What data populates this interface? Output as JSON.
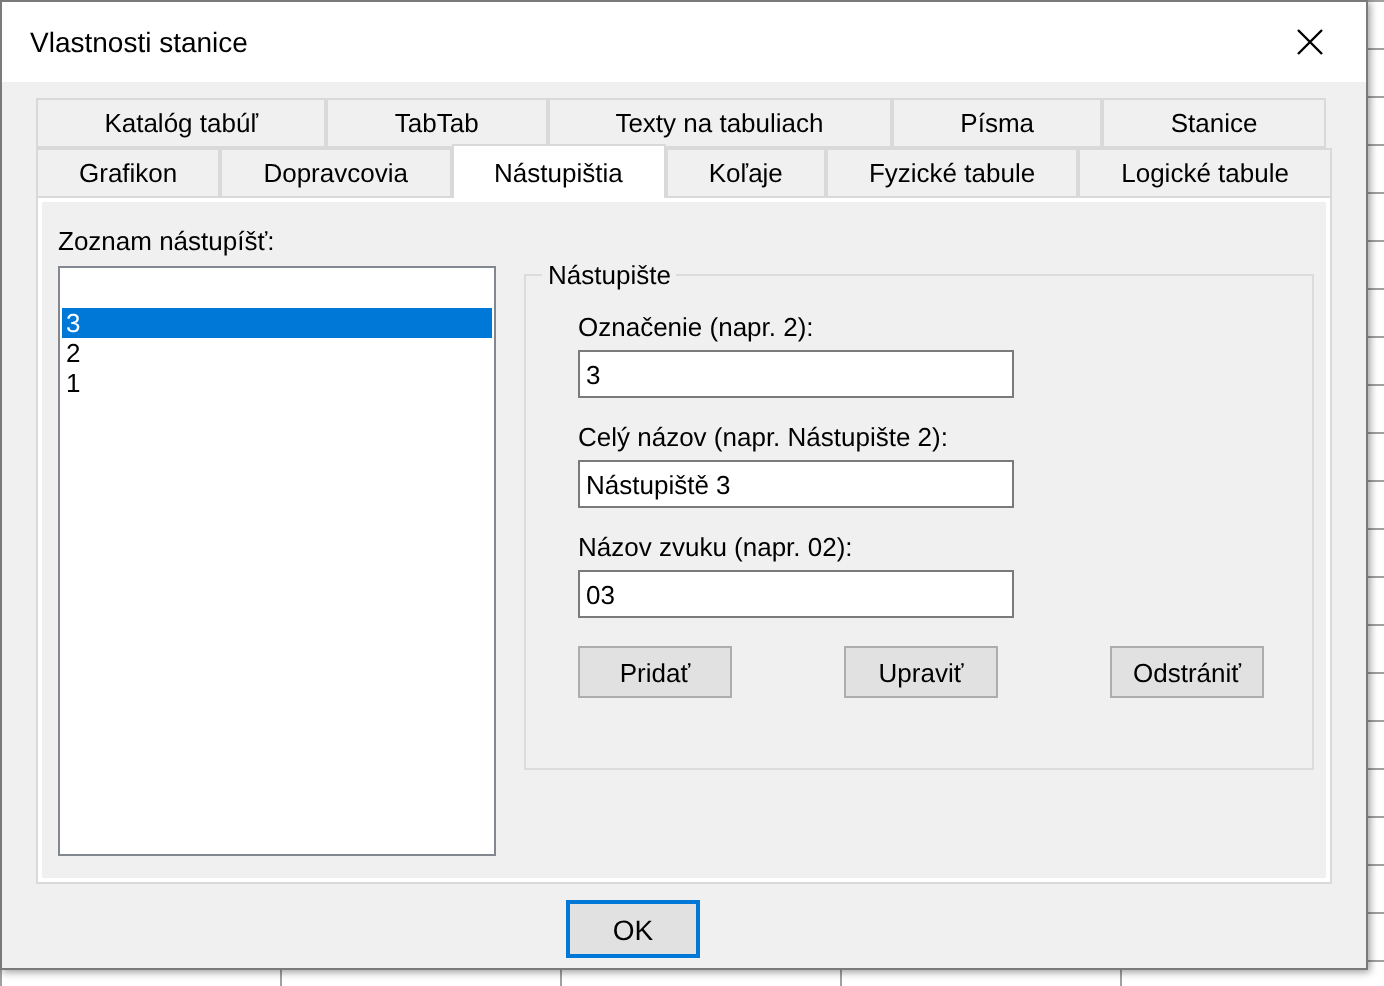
{
  "window": {
    "title": "Vlastnosti stanice"
  },
  "tab_rows": [
    [
      {
        "label": "Katalóg tabúľ",
        "selected": false
      },
      {
        "label": "TabTab",
        "selected": false
      },
      {
        "label": "Texty na tabuliach",
        "selected": false
      },
      {
        "label": "Písma",
        "selected": false
      },
      {
        "label": "Stanice",
        "selected": false
      }
    ],
    [
      {
        "label": "Grafikon",
        "selected": false
      },
      {
        "label": "Dopravcovia",
        "selected": false
      },
      {
        "label": "Nástupištia",
        "selected": true
      },
      {
        "label": "Koľaje",
        "selected": false
      },
      {
        "label": "Fyzické tabule",
        "selected": false
      },
      {
        "label": "Logické tabule",
        "selected": false
      }
    ]
  ],
  "platform_list": {
    "label": "Zoznam nástupíšť:",
    "items": [
      {
        "label": "3",
        "selected": true
      },
      {
        "label": "2",
        "selected": false
      },
      {
        "label": "1",
        "selected": false
      }
    ]
  },
  "group": {
    "title": "Nástupište",
    "fields": [
      {
        "label": "Označenie (napr. 2):",
        "value": "3"
      },
      {
        "label": "Celý názov (napr. Nástupište 2):",
        "value": "Nástupiště 3"
      },
      {
        "label": "Názov zvuku (napr. 02):",
        "value": "03"
      }
    ],
    "buttons": [
      "Pridať",
      "Upraviť",
      "Odstrániť"
    ]
  },
  "ok_button": "OK"
}
